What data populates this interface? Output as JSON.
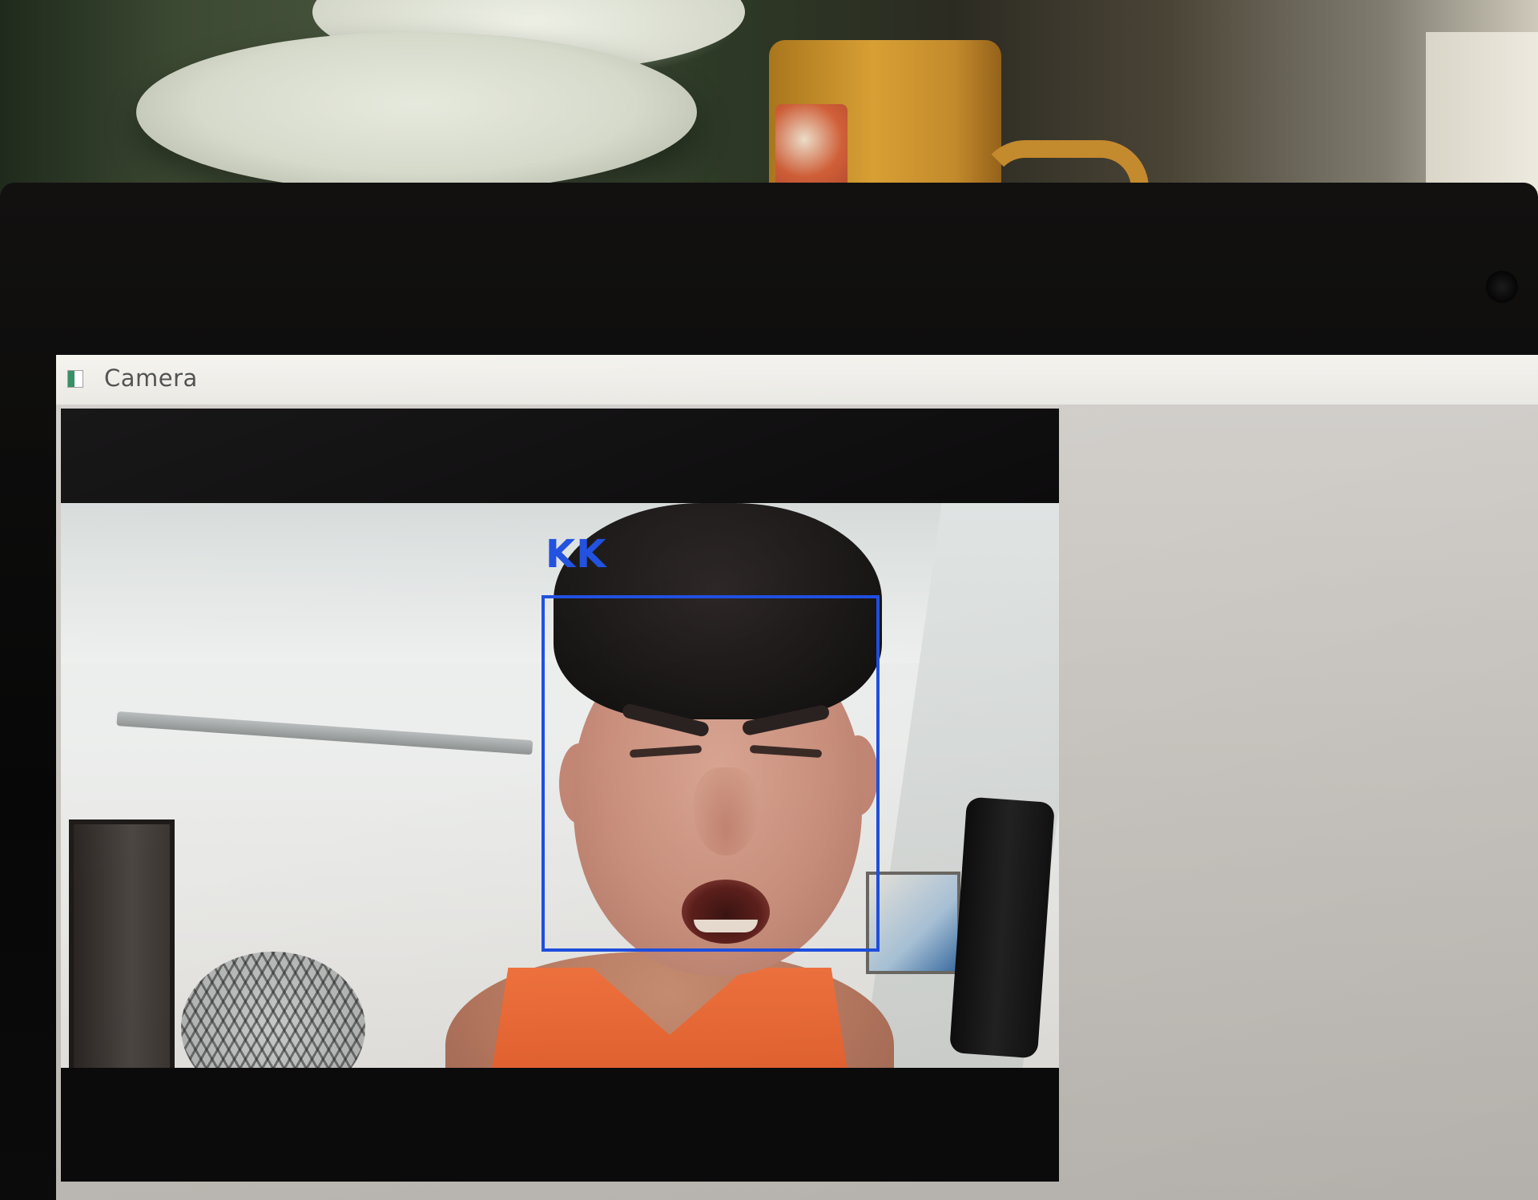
{
  "window": {
    "title": "Camera",
    "icon": "opencv-window-icon"
  },
  "detection": {
    "label": "KK",
    "box_color": "#1f4fe0"
  },
  "colors": {
    "titlebar": "#f1f0eb",
    "client_background": "#c8c4bf",
    "frame_letterbox": "#0c0b0c"
  }
}
